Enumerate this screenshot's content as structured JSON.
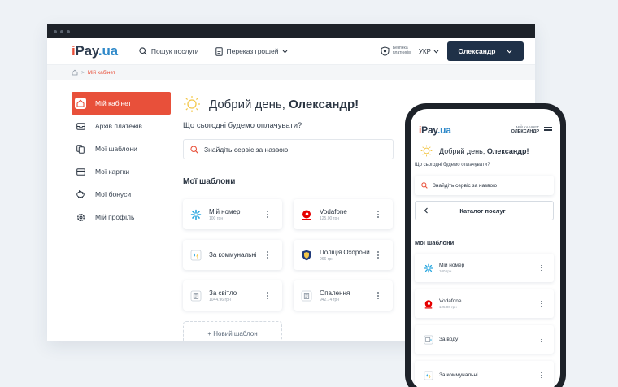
{
  "brand": {
    "i": "i",
    "pay": "Pay",
    "ua": ".ua",
    "accent": "#e8503a",
    "navy": "#1f3148"
  },
  "nav": {
    "search_label": "Пошук послуги",
    "transfer_label": "Переказ грошей",
    "safety_line1": "Безпека",
    "safety_line2": "платників",
    "lang": "УКР",
    "user": "Олександр"
  },
  "breadcrumb": {
    "current": "Мій кабінет"
  },
  "sidebar": {
    "items": [
      {
        "label": "Мій кабінет",
        "icon": "home-icon",
        "active": true
      },
      {
        "label": "Архів платежів",
        "icon": "inbox-icon"
      },
      {
        "label": "Мої шаблони",
        "icon": "copy-icon"
      },
      {
        "label": "Мої картки",
        "icon": "card-icon"
      },
      {
        "label": "Мої бонуси",
        "icon": "piggy-bank-icon"
      },
      {
        "label": "Мій профіль",
        "icon": "gear-icon"
      }
    ]
  },
  "main": {
    "greeting_prefix": "Добрий день,",
    "greeting_name": "Олександр!",
    "question": "Що сьогодні будемо оплачувати?",
    "search_placeholder": "Знайдіть сервіс за назвою",
    "templates_title": "Мої шаблони",
    "new_template": "+ Новий шаблон",
    "templates": [
      {
        "name": "Мій номер",
        "sub": "100 грн",
        "icon": "kyivstar-logo-icon"
      },
      {
        "name": "Vodafone",
        "sub": "125.00 грн",
        "icon": "vodafone-logo-icon"
      },
      {
        "name": "За коммунальні",
        "sub": "",
        "icon": "utilities-icon"
      },
      {
        "name": "Поліція Охорони",
        "sub": "966 грн",
        "icon": "police-shield-icon"
      },
      {
        "name": "За світло",
        "sub": "1044.96 грн",
        "icon": "bill-icon"
      },
      {
        "name": "Опалення",
        "sub": "942.74 грн",
        "icon": "bill-icon"
      }
    ]
  },
  "mobile": {
    "account_line1": "МІЙ КАБІНЕТ",
    "account_line2": "ОЛЕКСАНДР",
    "greeting_prefix": "Добрий день,",
    "greeting_name": "Олександр!",
    "question": "Що сьогодні будемо оплачувати?",
    "search_placeholder": "Знайдіть сервіс за назвою",
    "catalog": "Каталог послуг",
    "templates_title": "Мої шаблони",
    "templates": [
      {
        "name": "Мій номер",
        "sub": "100 грн",
        "icon": "kyivstar-logo-icon"
      },
      {
        "name": "Vodafone",
        "sub": "125.00 грн",
        "icon": "vodafone-logo-icon"
      },
      {
        "name": "За воду",
        "sub": "",
        "icon": "water-bill-icon"
      },
      {
        "name": "За коммунальні",
        "sub": "",
        "icon": "utilities-icon"
      }
    ]
  }
}
